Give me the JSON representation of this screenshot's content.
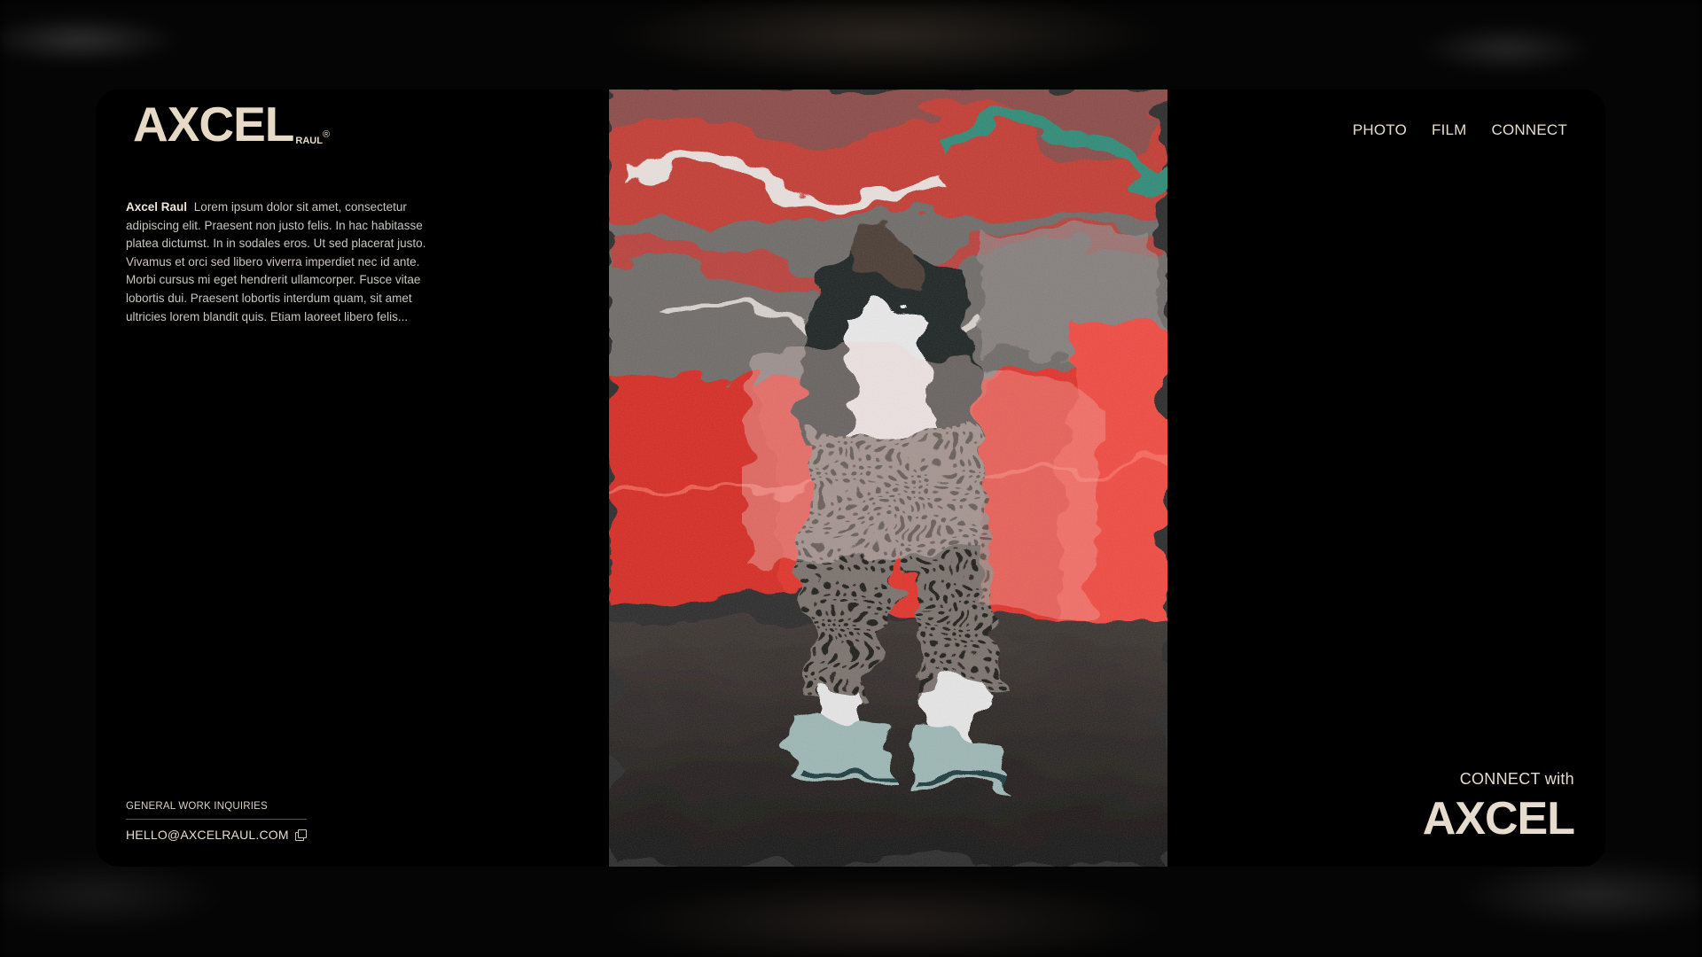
{
  "brand": {
    "logo_main": "AXCEL",
    "logo_sub": "RAUL",
    "logo_reg": "®"
  },
  "bio": {
    "name": "Axcel Raul",
    "text": "Lorem ipsum dolor sit amet, consectetur adipiscing elit. Praesent non justo felis. In hac habitasse platea dictumst. In in sodales eros. Ut sed placerat justo. Vivamus et orci sed libero viverra imperdiet nec id ante. Morbi cursus mi eget hendrerit ullamcorper. Fusce vitae lobortis dui. Praesent lobortis interdum quam, sit amet ultricies lorem blandit quis. Etiam laoreet libero felis..."
  },
  "nav": {
    "items": [
      {
        "label": "PHOTO"
      },
      {
        "label": "FILM"
      },
      {
        "label": "CONNECT"
      }
    ]
  },
  "inquiries": {
    "title": "GENERAL WORK INQUIRIES",
    "email": "HELLO@AXCELRAUL.COM",
    "copy_icon": "copy-icon"
  },
  "connect": {
    "prefix": "CONNECT with",
    "name": "AXCEL"
  },
  "colors": {
    "cream": "#e6d9c6",
    "background": "#000000",
    "red_accent": "#e02a24"
  }
}
